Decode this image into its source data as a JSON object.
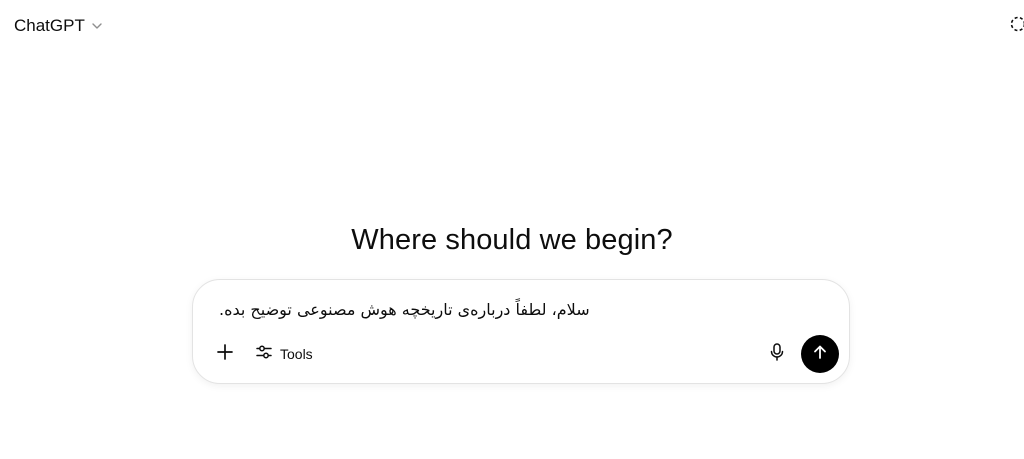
{
  "header": {
    "model_name": "ChatGPT",
    "model_dropdown_icon": "chevron-down-icon",
    "temporary_chat_icon": "dashed-circle-icon"
  },
  "main": {
    "title": "Where should we begin?"
  },
  "composer": {
    "input_value": ".سلام، لطفاً درباره‌ی تاریخچه هوش مصنوعی توضیح بده",
    "plus_icon": "plus-icon",
    "tools_label": "Tools",
    "tools_icon": "sliders-icon",
    "mic_icon": "microphone-icon",
    "send_icon": "arrow-up-icon",
    "send_button_color": "#000000"
  }
}
